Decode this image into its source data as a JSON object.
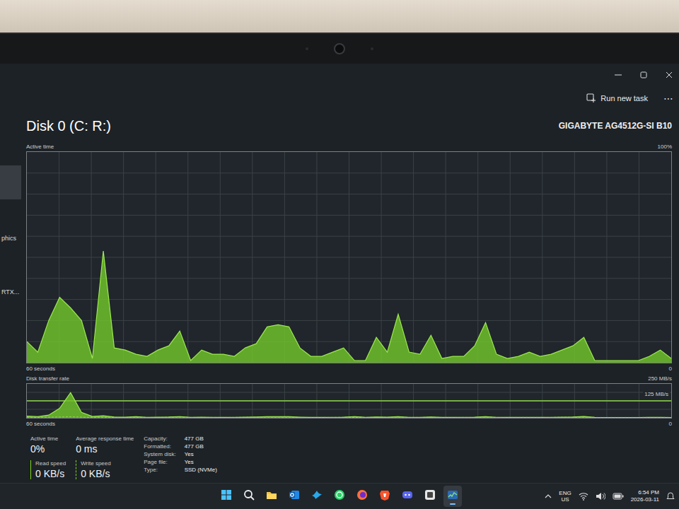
{
  "toolbar": {
    "run_new_task": "Run new task",
    "more": "⋯"
  },
  "sidebar": {
    "items": [
      {
        "label": "",
        "selected": true
      },
      {
        "label": "phics",
        "selected": false
      },
      {
        "label": "RTX...",
        "selected": false
      }
    ]
  },
  "disk": {
    "title": "Disk 0 (C: R:)",
    "model": "GIGABYTE AG4512G-SI B10"
  },
  "active_chart": {
    "label": "Active time",
    "max": "100%",
    "min": "0",
    "span": "60 seconds",
    "series": [
      {
        "name": "active",
        "kind": "solid",
        "values": [
          10,
          5,
          20,
          31,
          26,
          20,
          2,
          53,
          7,
          6,
          4,
          3,
          6,
          8,
          15,
          1,
          6,
          4,
          4,
          3,
          7,
          9,
          17,
          18,
          17,
          7,
          3,
          3,
          5,
          7,
          1,
          1,
          12,
          5,
          23,
          5,
          4,
          13,
          2,
          3,
          3,
          8,
          19,
          4,
          2,
          3,
          5,
          3,
          4,
          6,
          8,
          12,
          1,
          1,
          1,
          1,
          1,
          3,
          6,
          2
        ]
      }
    ]
  },
  "transfer_chart": {
    "label": "Disk transfer rate",
    "max": "250 MB/s",
    "mark": "125 MB/s",
    "min": "0",
    "span": "60 seconds",
    "series": [
      {
        "name": "read",
        "kind": "solid",
        "values": [
          12,
          8,
          20,
          70,
          185,
          40,
          10,
          15,
          6,
          5,
          8,
          4,
          5,
          6,
          9,
          4,
          5,
          4,
          3,
          4,
          5,
          6,
          8,
          9,
          8,
          5,
          3,
          3,
          4,
          5,
          9,
          4,
          6,
          5,
          8,
          4,
          4,
          6,
          3,
          3,
          4,
          5,
          8,
          4,
          3,
          3,
          4,
          3,
          4,
          5,
          6,
          10,
          3,
          2,
          2,
          2,
          2,
          3,
          4,
          2
        ]
      },
      {
        "name": "write",
        "kind": "dashed",
        "values": [
          4,
          3,
          5,
          6,
          8,
          5,
          3,
          4,
          3,
          3,
          4,
          3,
          3,
          4,
          5,
          3,
          3,
          3,
          3,
          3,
          4,
          4,
          5,
          5,
          5,
          3,
          3,
          3,
          3,
          4,
          3,
          3,
          4,
          3,
          5,
          3,
          3,
          4,
          3,
          3,
          3,
          3,
          5,
          3,
          3,
          3,
          3,
          3,
          3,
          4,
          4,
          5,
          3,
          3,
          3,
          3,
          3,
          3,
          3,
          3
        ]
      }
    ]
  },
  "stats": [
    {
      "label": "Active time",
      "value": "0%"
    },
    {
      "label": "Average response time",
      "value": "0 ms"
    }
  ],
  "speeds": [
    {
      "label": "Read speed",
      "value": "0 KB/s",
      "kind": "solid"
    },
    {
      "label": "Write speed",
      "value": "0 KB/s",
      "kind": "dashed"
    }
  ],
  "properties": [
    {
      "key": "Capacity:",
      "value": "477 GB"
    },
    {
      "key": "Formatted:",
      "value": "477 GB"
    },
    {
      "key": "System disk:",
      "value": "Yes"
    },
    {
      "key": "Page file:",
      "value": "Yes"
    },
    {
      "key": "Type:",
      "value": "SSD (NVMe)"
    }
  ],
  "taskbar": {
    "apps": [
      {
        "kind": "start",
        "selected": false
      },
      {
        "kind": "search",
        "selected": false
      },
      {
        "kind": "explorer",
        "selected": false
      },
      {
        "kind": "outlook",
        "selected": false
      },
      {
        "kind": "messenger",
        "selected": false
      },
      {
        "kind": "whatsapp",
        "selected": false
      },
      {
        "kind": "firefox",
        "selected": false
      },
      {
        "kind": "brave",
        "selected": false
      },
      {
        "kind": "discord",
        "selected": false
      },
      {
        "kind": "app",
        "selected": false
      },
      {
        "kind": "taskmanager",
        "selected": true
      }
    ],
    "language": {
      "line1": "ENG",
      "line2": "US"
    },
    "time": "6:54 PM",
    "date": "2026-03-11"
  }
}
